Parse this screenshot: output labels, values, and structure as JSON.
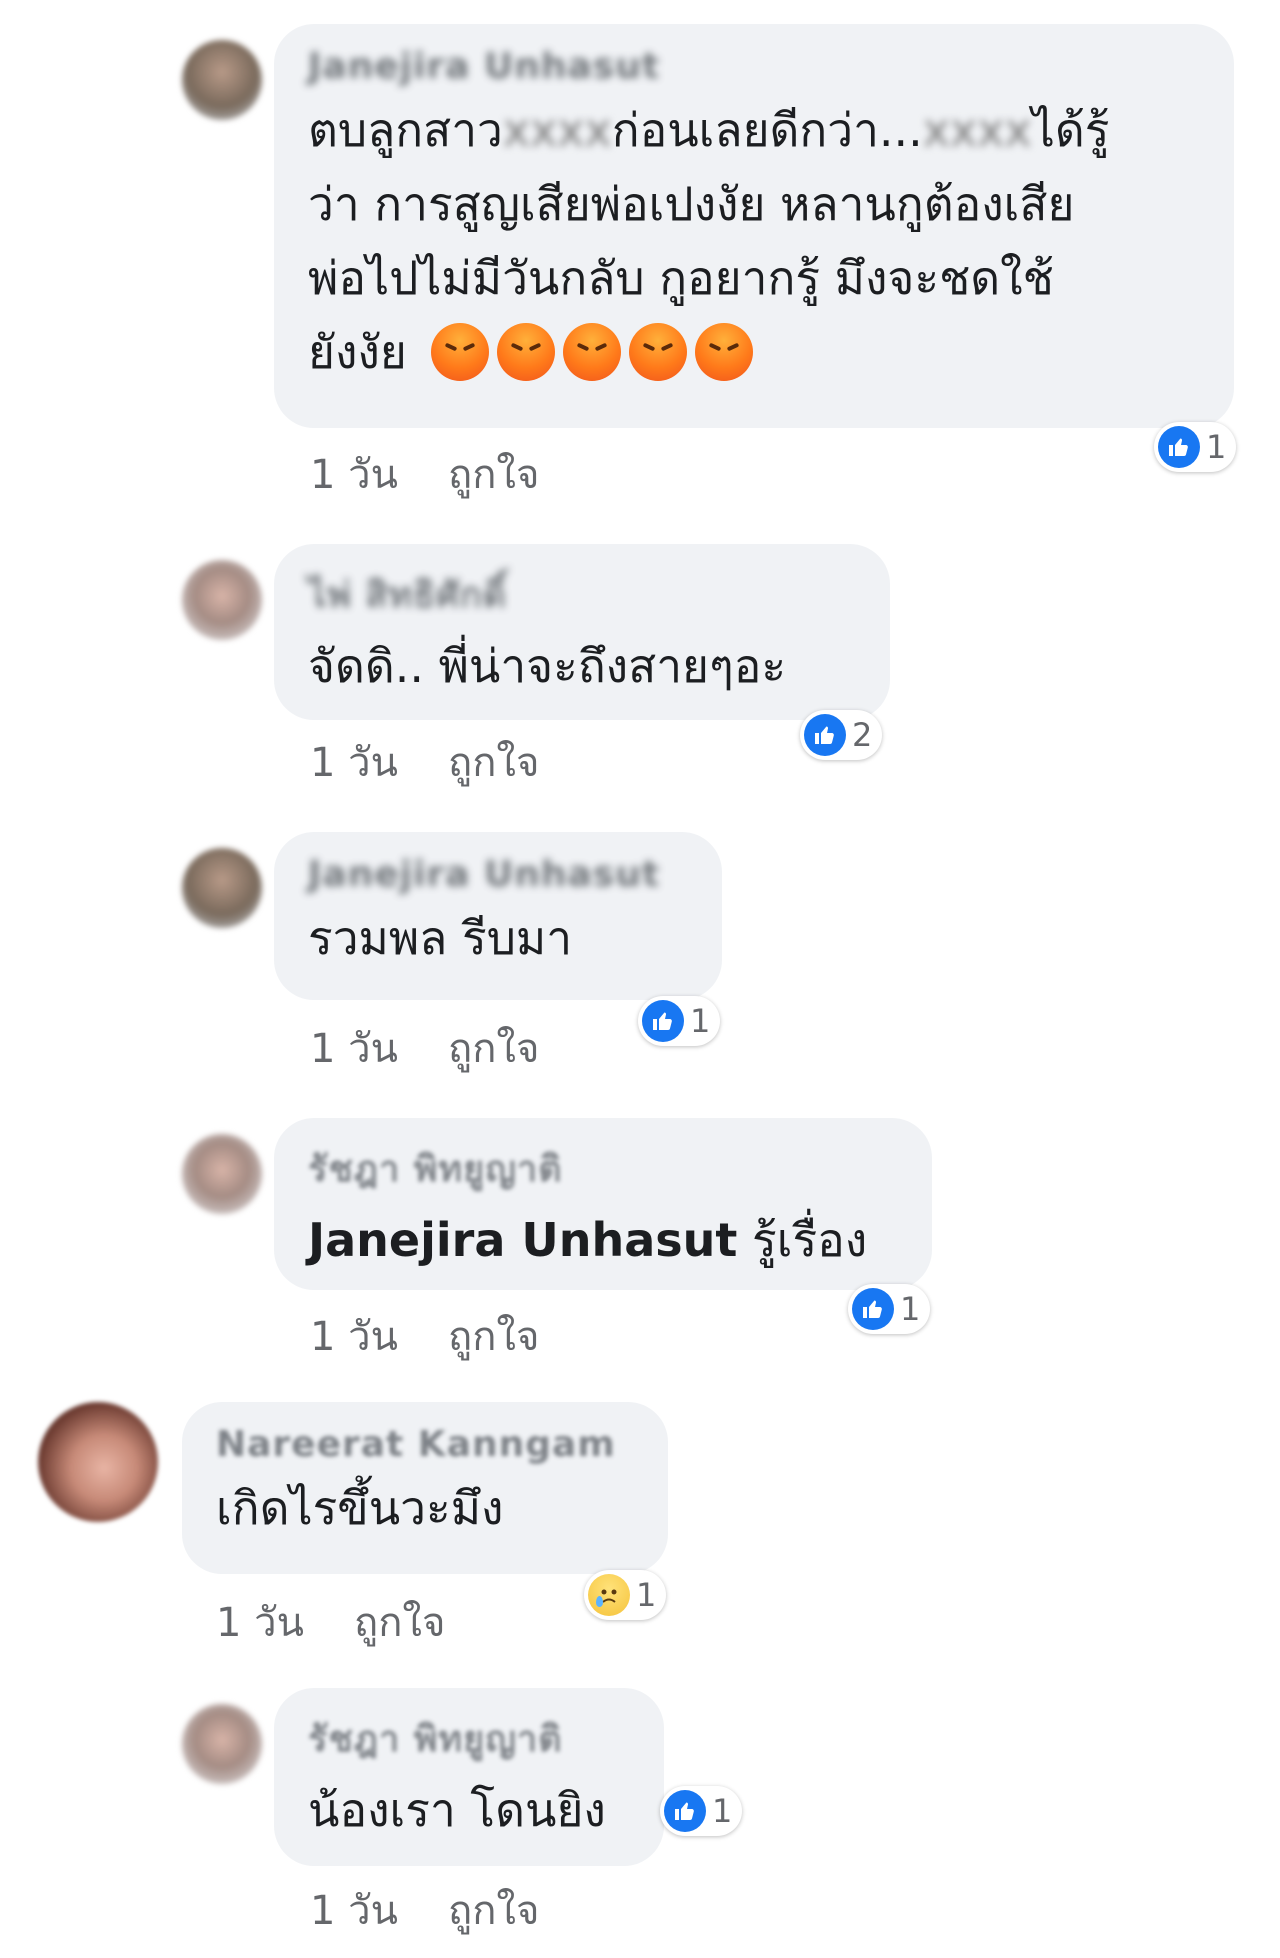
{
  "comments": [
    {
      "name": "Janejira Unhasut",
      "lines": [
        "ตบลูกสาว",
        "ก่อนเลยดีกว่า...",
        "ได้รู้",
        "ว่า การสูญเสียพ่อเปงงัย หลานกูต้องเสีย",
        "พ่อไปไม่มีวันกลับ กูอยากรู้ มึงจะชดใช้",
        "ยังงัย"
      ],
      "time": "1 วัน",
      "like": "ถูกใจ",
      "reaction_count": "1"
    },
    {
      "name": "ไพ่ สิทธิศักดิ์",
      "text": "จัดดิ.. พี่น่าจะถึงสายๆอะ",
      "time": "1 วัน",
      "like": "ถูกใจ",
      "reaction_count": "2"
    },
    {
      "name": "Janejira Unhasut",
      "text": "รวมพล รีบมา",
      "time": "1 วัน",
      "like": "ถูกใจ",
      "reaction_count": "1"
    },
    {
      "name": "รัชฎา พิทยูญาติ",
      "mention": "Janejira Unhasut",
      "text": " รู้เรื่อง",
      "time": "1 วัน",
      "like": "ถูกใจ",
      "reaction_count": "1"
    },
    {
      "name": "Nareerat Kanngam",
      "text": "เกิดไรขึ้นวะมึง",
      "time": "1 วัน",
      "like": "ถูกใจ",
      "reaction_count": "1"
    },
    {
      "name": "รัชฎา พิทยูญาติ",
      "text": "น้องเรา โดนยิง",
      "time": "1 วัน",
      "like": "ถูกใจ",
      "reaction_count": "1"
    }
  ],
  "icons": {
    "like": "like-icon",
    "sad": "sad-icon",
    "angry": "angry-emoji"
  },
  "colors": {
    "bubble": "#f0f2f5",
    "like_blue": "#1877f2",
    "meta": "#65676b"
  }
}
